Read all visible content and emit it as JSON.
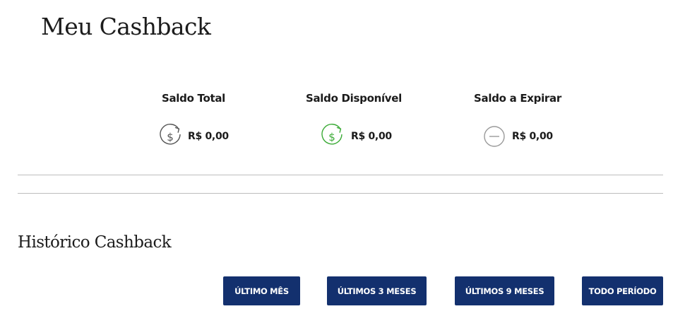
{
  "page": {
    "title": "Meu Cashback"
  },
  "balances": [
    {
      "label": "Saldo Total",
      "amount": "R$ 0,00",
      "icon": "dollar-refresh-icon",
      "icon_color": "#555555"
    },
    {
      "label": "Saldo Disponível",
      "amount": "R$ 0,00",
      "icon": "dollar-refresh-icon",
      "icon_color": "#3aaa35"
    },
    {
      "label": "Saldo a Expirar",
      "amount": "R$ 0,00",
      "icon": "minus-circle-icon",
      "icon_color": "#9a9a9a"
    }
  ],
  "history": {
    "title": "Histórico Cashback",
    "filters": [
      "ÚLTIMO MÊS",
      "ÚLTIMOS 3 MESES",
      "ÚLTIMOS 9 MESES",
      "TODO PERÍODO"
    ]
  },
  "colors": {
    "button_bg": "#13306e",
    "button_text": "#ffffff",
    "divider": "#bdbdbd"
  }
}
